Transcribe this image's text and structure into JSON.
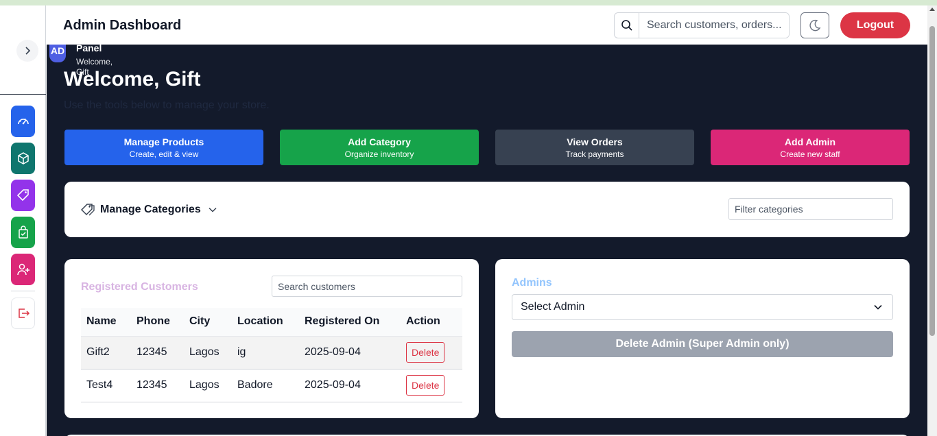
{
  "header": {
    "title": "Admin Dashboard",
    "search_placeholder": "Search customers, orders...",
    "logout_label": "Logout"
  },
  "panel": {
    "avatar": "AD",
    "title": "Panel",
    "welcome": "Welcome,",
    "name": "Gift"
  },
  "main": {
    "welcome": "Welcome, Gift",
    "subtitle": "Use the tools below to manage your store."
  },
  "actions": [
    {
      "title": "Manage Products",
      "subtitle": "Create, edit & view",
      "color": "#2563eb"
    },
    {
      "title": "Add Category",
      "subtitle": "Organize inventory",
      "color": "#16a34a"
    },
    {
      "title": "View Orders",
      "subtitle": "Track payments",
      "color": "#374151"
    },
    {
      "title": "Add Admin",
      "subtitle": "Create new staff",
      "color": "#db2777"
    }
  ],
  "categories": {
    "title": "Manage Categories",
    "filter_placeholder": "Filter categories"
  },
  "customers": {
    "title": "Registered Customers",
    "search_placeholder": "Search customers",
    "columns": [
      "Name",
      "Phone",
      "City",
      "Location",
      "Registered On",
      "Action"
    ],
    "rows": [
      {
        "name": "Gift2",
        "phone": "12345",
        "city": "Lagos",
        "location": "ig",
        "registered": "2025-09-04",
        "action": "Delete"
      },
      {
        "name": "Test4",
        "phone": "12345",
        "city": "Lagos",
        "location": "Badore",
        "registered": "2025-09-04",
        "action": "Delete"
      }
    ]
  },
  "admins": {
    "title": "Admins",
    "select_value": "Select Admin",
    "delete_label": "Delete Admin (Super Admin only)"
  },
  "sidebar": {
    "items": [
      {
        "icon": "dashboard-gauge-icon",
        "color": "#2563eb"
      },
      {
        "icon": "box-icon",
        "color": "#0f766e"
      },
      {
        "icon": "tag-icon",
        "color": "#9333ea"
      },
      {
        "icon": "shopping-bag-check-icon",
        "color": "#16a34a"
      },
      {
        "icon": "user-add-icon",
        "color": "#db2777"
      },
      {
        "icon": "logout-icon",
        "color": "#ffffff"
      }
    ]
  },
  "colors": {
    "accent_dark": "#131a2b",
    "danger": "#dc3545",
    "customers_title": "#d8b4e2",
    "admins_title": "#93c5fd"
  }
}
